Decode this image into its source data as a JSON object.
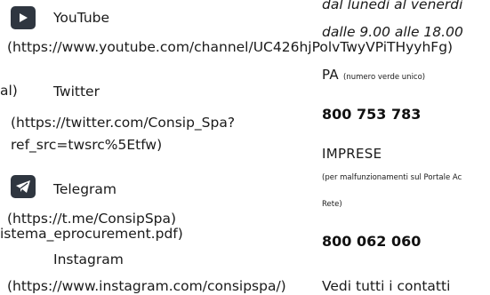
{
  "social": {
    "youtube": {
      "label": "YouTube",
      "url": "(https://www.youtube.com/channel/UC426hjPolvTwyVPiTHyyhFg)"
    },
    "clipped_prefix": "al)",
    "twitter": {
      "label": "Twitter",
      "url_line1": "(https://twitter.com/Consip_Spa?",
      "url_line2": "ref_src=twsrc%5Etfw)"
    },
    "telegram": {
      "label": "Telegram",
      "url": "(https://t.me/ConsipSpa)"
    },
    "clipped_pdf": "istema_eprocurement.pdf)",
    "instagram": {
      "label": "Instagram",
      "url": "(https://www.instagram.com/consipspa/)"
    }
  },
  "contacts": {
    "hours_line1": "dal lunedì al venerdì",
    "hours_line2": "dalle 9.00 alle 18.00",
    "pa_label": "PA",
    "pa_note": "(numero verde unico)",
    "pa_number": "800 753 783",
    "imprese_label": "IMPRESE",
    "imprese_note_line1": "(per malfunzionamenti sul Portale Ac",
    "imprese_note_line2": "Rete)",
    "imprese_number": "800 062 060",
    "all_contacts_link": "Vedi tutti i contatti"
  }
}
